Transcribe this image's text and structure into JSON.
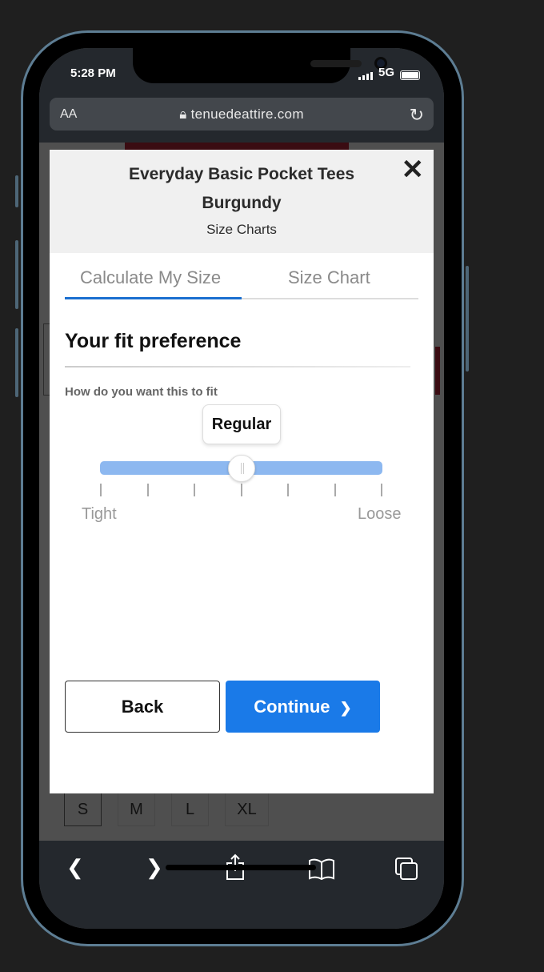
{
  "status_bar": {
    "time": "5:28 PM",
    "network": "5G"
  },
  "browser": {
    "text_size_label": "AA",
    "url": "tenuedeattire.com",
    "lock_icon": "lock-icon",
    "reload_icon": "reload-icon"
  },
  "background_page": {
    "sizes": [
      "S",
      "M",
      "L",
      "XL"
    ],
    "selected_size": "S"
  },
  "modal": {
    "title": "Everyday Basic Pocket Tees",
    "subtitle": "Burgundy",
    "caption": "Size Charts",
    "close_icon": "close-icon",
    "tabs": [
      {
        "label": "Calculate My Size",
        "active": true
      },
      {
        "label": "Size Chart",
        "active": false
      }
    ],
    "heading": "Your fit preference",
    "question": "How do you want this to fit",
    "slider": {
      "value_label": "Regular",
      "steps": 7,
      "selected_step_fraction": 0.5,
      "min_label": "Tight",
      "max_label": "Loose"
    },
    "back_label": "Back",
    "continue_label": "Continue",
    "accent_color": "#1a7ae8"
  },
  "toolbar": {
    "icons": [
      "back-icon",
      "forward-icon",
      "share-icon",
      "bookmarks-icon",
      "tabs-icon"
    ]
  }
}
